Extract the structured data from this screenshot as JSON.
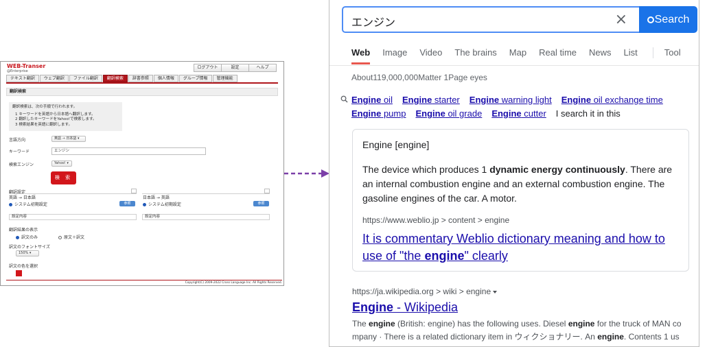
{
  "left_app": {
    "logo": "WEB-Transer",
    "logo_sub": "@Enterprise",
    "top_buttons": [
      "ログアウト",
      "設定",
      "ヘルプ"
    ],
    "tabs": [
      "テキスト翻訳",
      "ウェブ翻訳",
      "ファイル翻訳",
      "翻訳検索",
      "辞書参照",
      "個人情報",
      "グループ情報",
      "管理機能"
    ],
    "active_tab": "翻訳検索",
    "section_title": "翻訳検索",
    "info_lines": [
      "翻訳検索は、次の手順で行われます。",
      "1 キーワードを英語から日本語へ翻訳します。",
      "2 翻訳したキーワードをYahoo!で検索します。",
      "3 検索結果を英語に翻訳します。"
    ],
    "lang_dir_label": "言語方向",
    "lang_dir_value": "英語 → 日本語",
    "keyword_label": "キーワード",
    "keyword_value": "エンジン",
    "engine_label": "検索エンジン",
    "engine_value": "Yahoo!",
    "search_button": "検 索",
    "trans_settings_label": "翻訳設定",
    "pair_en_ja": "英語 → 日本語",
    "pair_ja_en": "日本語 → 英語",
    "system_default": "システム初期設定",
    "ref_button": "参照",
    "settings_content": "設定内容",
    "result_display_label": "翻訳結果の表示",
    "opt_translation_only": "訳文のみ",
    "opt_source_plus": "原文＋訳文",
    "font_size_label": "訳文のフォントサイズ",
    "font_size_value": "150%",
    "color_label": "訳文の色を選択",
    "copyright": "Copyright(C) 2009-2022 Cross Language Inc. All Rights Reserved."
  },
  "search": {
    "query": "エンジン",
    "clear_glyph": "×",
    "button_label": "Search",
    "tabs": [
      "Web",
      "Image",
      "Video",
      "The brains",
      "Map",
      "Real time",
      "News",
      "List"
    ],
    "tool_label": "Tool",
    "result_count": "About119,000,000Matter 1Page eyes",
    "related_row1": [
      {
        "bold": "Engine",
        "rest": " oil"
      },
      {
        "bold": "Engine",
        "rest": " starter"
      },
      {
        "bold": "Engine",
        "rest": " warning light"
      },
      {
        "bold": "Engine",
        "rest": " oil exchange time"
      }
    ],
    "related_row2": [
      {
        "bold": "Engine",
        "rest": " pump"
      },
      {
        "bold": "Engine",
        "rest": " oil grade"
      },
      {
        "bold": "Engine",
        "rest": " cutter"
      }
    ],
    "related_plain": "I search it in this",
    "card": {
      "term": "Engine [engine]",
      "def_pre": "The device which produces 1 ",
      "def_bold": "dynamic energy continuously",
      "def_post": ". There are an internal combustion engine and an external combustion engine. The gasoline engines of the car. A motor.",
      "url": "https://www.weblio.jp > content >  engine",
      "title_pre": "It is commentary Weblio dictionary meaning and how to use of \"the ",
      "title_bold": "engine",
      "title_post": "\" clearly"
    },
    "result2": {
      "url": "https://ja.wikipedia.org > wiki >  engine",
      "title_bold": "Engine",
      "title_rest": " - Wikipedia",
      "snip1_a": "The ",
      "snip1_b": "engine",
      "snip1_c": " (British: engine) has the following uses. Diesel ",
      "snip1_d": "engine",
      "snip1_e": " for the truck of MAN co",
      "snip2_a": "mpany · There is a related dictionary item in ウィクショナリー. An ",
      "snip2_b": "engine",
      "snip2_c": ". Contents 1 us"
    }
  },
  "colors": {
    "accent_blue": "#1a73e8",
    "link": "#1a0dab",
    "brand_red": "#b0151b",
    "arrow_purple": "#7b3fa8"
  }
}
